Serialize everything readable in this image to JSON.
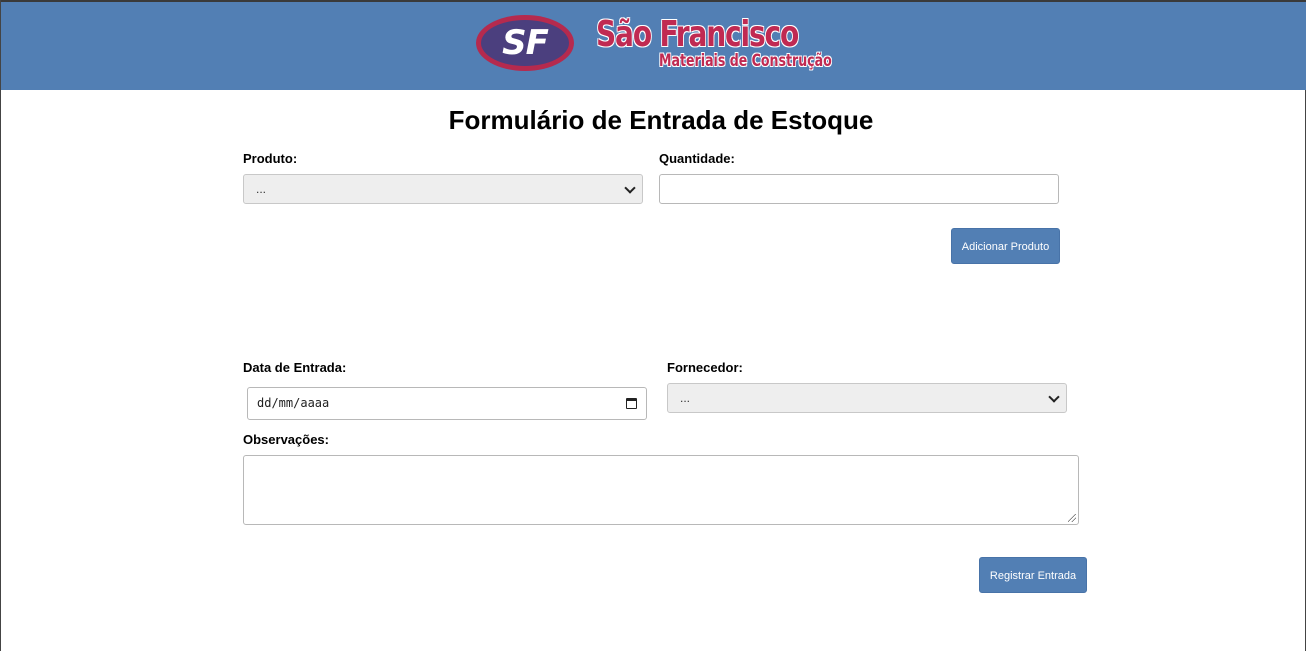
{
  "header": {
    "logo_monogram": "SF",
    "brand_name": "São Francisco",
    "brand_tagline": "Materiais de Construção",
    "background_color": "#527fb4",
    "brand_color": "#c02a52"
  },
  "form": {
    "title": "Formulário de Entrada de Estoque",
    "produto": {
      "label": "Produto:",
      "selected": "..."
    },
    "quantidade": {
      "label": "Quantidade:",
      "value": ""
    },
    "add_button": "Adicionar Produto",
    "data_entrada": {
      "label": "Data de Entrada:",
      "placeholder": "dd/mm/aaaa"
    },
    "fornecedor": {
      "label": "Fornecedor:",
      "selected": "..."
    },
    "observacoes": {
      "label": "Observações:",
      "value": ""
    },
    "submit_button": "Registrar Entrada"
  }
}
